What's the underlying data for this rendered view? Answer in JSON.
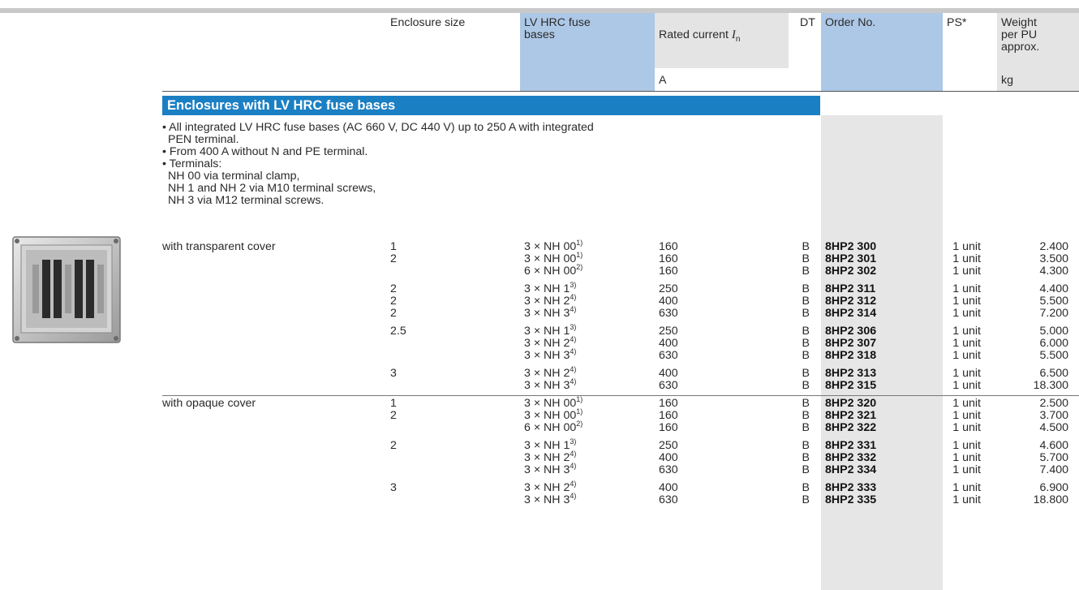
{
  "header": {
    "enclosure_size": "Enclosure size",
    "fuse_bases": "LV HRC fuse\nbases",
    "rated_current_prefix": "Rated current ",
    "rated_current_symbol": "I",
    "rated_current_sub": "n",
    "dt": "DT",
    "order_no": "Order No.",
    "ps": "PS*",
    "weight": "Weight\nper PU\napprox.",
    "unit_current": "A",
    "unit_weight": "kg"
  },
  "section_title": "Enclosures with LV HRC fuse bases",
  "notes": [
    "• All integrated LV HRC fuse bases (AC 660 V, DC 440 V) up to 250 A with integrated",
    "PEN terminal.",
    "• From 400 A without N and PE terminal.",
    "• Terminals:",
    "NH 00 via terminal clamp,",
    "NH 1 and NH 2 via M10 terminal screws,",
    "NH 3 via M12 terminal screws."
  ],
  "groups": [
    {
      "label": "with transparent cover",
      "blocks": [
        {
          "rows": [
            {
              "size": "1",
              "fuse": "3 × NH 00",
              "sup": "1)",
              "current": "160",
              "dt": "B",
              "order": "8HP2 300",
              "ps": "1 unit",
              "weight": "2.400"
            },
            {
              "size": "2",
              "fuse": "3 × NH 00",
              "sup": "1)",
              "current": "160",
              "dt": "B",
              "order": "8HP2 301",
              "ps": "1 unit",
              "weight": "3.500"
            },
            {
              "size": "",
              "fuse": "6 × NH 00",
              "sup": "2)",
              "current": "160",
              "dt": "B",
              "order": "8HP2 302",
              "ps": "1 unit",
              "weight": "4.300"
            }
          ]
        },
        {
          "rows": [
            {
              "size": "2",
              "fuse": "3 × NH 1",
              "sup": "3)",
              "current": "250",
              "dt": "B",
              "order": "8HP2 311",
              "ps": "1 unit",
              "weight": "4.400"
            },
            {
              "size": "2",
              "fuse": "3 × NH 2",
              "sup": "4)",
              "current": "400",
              "dt": "B",
              "order": "8HP2 312",
              "ps": "1 unit",
              "weight": "5.500"
            },
            {
              "size": "2",
              "fuse": "3 × NH 3",
              "sup": "4)",
              "current": "630",
              "dt": "B",
              "order": "8HP2 314",
              "ps": "1 unit",
              "weight": "7.200"
            }
          ]
        },
        {
          "rows": [
            {
              "size": "2.5",
              "fuse": "3 × NH 1",
              "sup": "3)",
              "current": "250",
              "dt": "B",
              "order": "8HP2 306",
              "ps": "1 unit",
              "weight": "5.000"
            },
            {
              "size": "",
              "fuse": "3 × NH 2",
              "sup": "4)",
              "current": "400",
              "dt": "B",
              "order": "8HP2 307",
              "ps": "1 unit",
              "weight": "6.000"
            },
            {
              "size": "",
              "fuse": "3 × NH 3",
              "sup": "4)",
              "current": "630",
              "dt": "B",
              "order": "8HP2 318",
              "ps": "1 unit",
              "weight": "5.500"
            }
          ]
        },
        {
          "rows": [
            {
              "size": "3",
              "fuse": "3 × NH 2",
              "sup": "4)",
              "current": "400",
              "dt": "B",
              "order": "8HP2 313",
              "ps": "1 unit",
              "weight": "6.500"
            },
            {
              "size": "",
              "fuse": "3 × NH 3",
              "sup": "4)",
              "current": "630",
              "dt": "B",
              "order": "8HP2 315",
              "ps": "1 unit",
              "weight": "18.300"
            }
          ]
        }
      ]
    },
    {
      "label": "with opaque cover",
      "blocks": [
        {
          "rows": [
            {
              "size": "1",
              "fuse": "3 × NH 00",
              "sup": "1)",
              "current": "160",
              "dt": "B",
              "order": "8HP2 320",
              "ps": "1 unit",
              "weight": "2.500"
            },
            {
              "size": "2",
              "fuse": "3 × NH 00",
              "sup": "1)",
              "current": "160",
              "dt": "B",
              "order": "8HP2 321",
              "ps": "1 unit",
              "weight": "3.700"
            },
            {
              "size": "",
              "fuse": "6 × NH 00",
              "sup": "2)",
              "current": "160",
              "dt": "B",
              "order": "8HP2 322",
              "ps": "1 unit",
              "weight": "4.500"
            }
          ]
        },
        {
          "rows": [
            {
              "size": "2",
              "fuse": "3 × NH 1",
              "sup": "3)",
              "current": "250",
              "dt": "B",
              "order": "8HP2 331",
              "ps": "1 unit",
              "weight": "4.600"
            },
            {
              "size": "",
              "fuse": "3 × NH 2",
              "sup": "4)",
              "current": "400",
              "dt": "B",
              "order": "8HP2 332",
              "ps": "1 unit",
              "weight": "5.700"
            },
            {
              "size": "",
              "fuse": "3 × NH 3",
              "sup": "4)",
              "current": "630",
              "dt": "B",
              "order": "8HP2 334",
              "ps": "1 unit",
              "weight": "7.400"
            }
          ]
        },
        {
          "rows": [
            {
              "size": "3",
              "fuse": "3 × NH 2",
              "sup": "4)",
              "current": "400",
              "dt": "B",
              "order": "8HP2 333",
              "ps": "1 unit",
              "weight": "6.900"
            },
            {
              "size": "",
              "fuse": "3 × NH 3",
              "sup": "4)",
              "current": "630",
              "dt": "B",
              "order": "8HP2 335",
              "ps": "1 unit",
              "weight": "18.800"
            }
          ]
        }
      ]
    }
  ],
  "photo_icon": "enclosure-with-fuse-bases-photo",
  "colors": {
    "section_blue": "#1b7fc3",
    "header_blue": "#adc8e6",
    "header_gray": "#e4e4e4",
    "order_col_gray": "#e6e6e6"
  }
}
